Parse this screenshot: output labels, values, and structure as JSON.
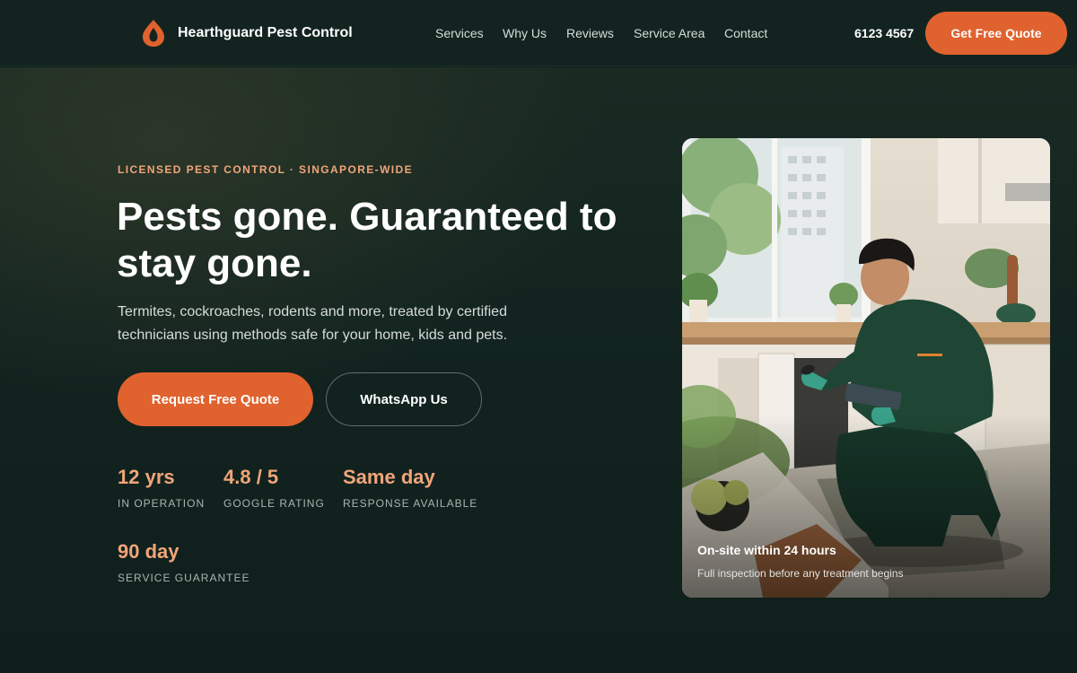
{
  "brand": {
    "name": "Hearthguard Pest Control",
    "logo_icon": "flame-drop-icon",
    "accent_color": "#e0622e"
  },
  "nav": {
    "items": [
      "Services",
      "Why Us",
      "Reviews",
      "Service Area",
      "Contact"
    ]
  },
  "header": {
    "phone": "6123 4567",
    "cta_label": "Get Free Quote"
  },
  "hero": {
    "eyebrow": "LICENSED PEST CONTROL · SINGAPORE-WIDE",
    "headline": "Pests gone. Guaranteed to stay gone.",
    "subtext": "Termites, cockroaches, rodents and more, treated by certified technicians using methods safe for your home, kids and pets.",
    "primary_cta": "Request Free Quote",
    "secondary_cta": "WhatsApp Us",
    "stats": [
      {
        "value": "12 yrs",
        "label": "IN OPERATION"
      },
      {
        "value": "4.8 / 5",
        "label": "GOOGLE RATING"
      },
      {
        "value": "Same day",
        "label": "RESPONSE AVAILABLE"
      },
      {
        "value": "90 day",
        "label": "SERVICE GUARANTEE"
      }
    ]
  },
  "photo": {
    "caption_title": "On-site within 24 hours",
    "caption_subtitle": "Full inspection before any treatment begins"
  }
}
